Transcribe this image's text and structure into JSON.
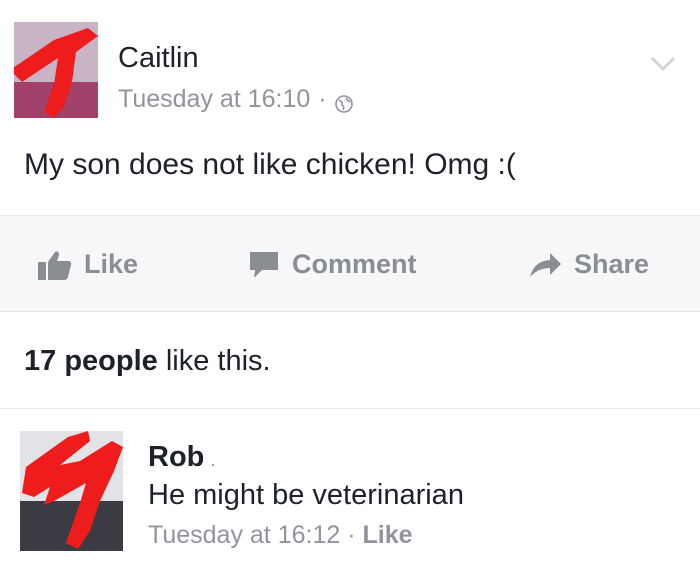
{
  "post": {
    "author": "Caitlin",
    "time": "Tuesday at 16:10",
    "separator": "·",
    "text": "My son does not like chicken! Omg :("
  },
  "actions": {
    "like": "Like",
    "comment": "Comment",
    "share": "Share"
  },
  "likes": {
    "count_text": "17 people",
    "suffix": " like this."
  },
  "comment": {
    "author": "Rob",
    "author_dot": ".",
    "text": "He might be veterinarian",
    "time": "Tuesday at 16:12",
    "separator": " · ",
    "like": "Like"
  },
  "colors": {
    "redaction": "#ee1c1c",
    "meta_gray": "#90949c",
    "action_gray": "#8a8d91"
  }
}
